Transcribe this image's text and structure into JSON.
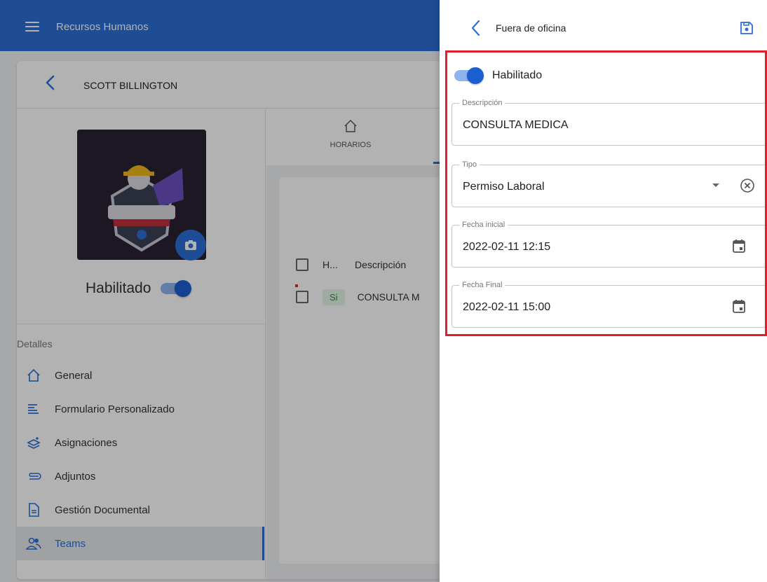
{
  "app": {
    "title": "Recursos Humanos"
  },
  "profile": {
    "name": "SCOTT BILLINGTON",
    "status_label": "Habilitado",
    "details_heading": "Detalles",
    "menu": [
      {
        "label": "General",
        "icon": "home-icon"
      },
      {
        "label": "Formulario Personalizado",
        "icon": "form-icon"
      },
      {
        "label": "Asignaciones",
        "icon": "layers-icon"
      },
      {
        "label": "Adjuntos",
        "icon": "paperclip-icon"
      },
      {
        "label": "Gestión Documental",
        "icon": "document-icon"
      },
      {
        "label": "Teams",
        "icon": "people-icon",
        "active": true
      }
    ]
  },
  "tabs": [
    {
      "label": "HORARIOS",
      "icon": "home-icon"
    }
  ],
  "table": {
    "headers": [
      "H...",
      "Descripción"
    ],
    "rows": [
      {
        "h": "Si",
        "desc": "CONSULTA M"
      }
    ]
  },
  "drawer": {
    "title": "Fuera de oficina",
    "enabled_label": "Habilitado",
    "fields": {
      "descripcion": {
        "label": "Descripción",
        "value": "CONSULTA MEDICA"
      },
      "tipo": {
        "label": "Tipo",
        "value": "Permiso Laboral"
      },
      "fecha_inicial": {
        "label": "Fecha inicial",
        "value": "2022-02-11 12:15"
      },
      "fecha_final": {
        "label": "Fecha Final",
        "value": "2022-02-11 15:00"
      }
    }
  },
  "colors": {
    "primary": "#2b6fd6",
    "highlight": "#e0202a"
  }
}
